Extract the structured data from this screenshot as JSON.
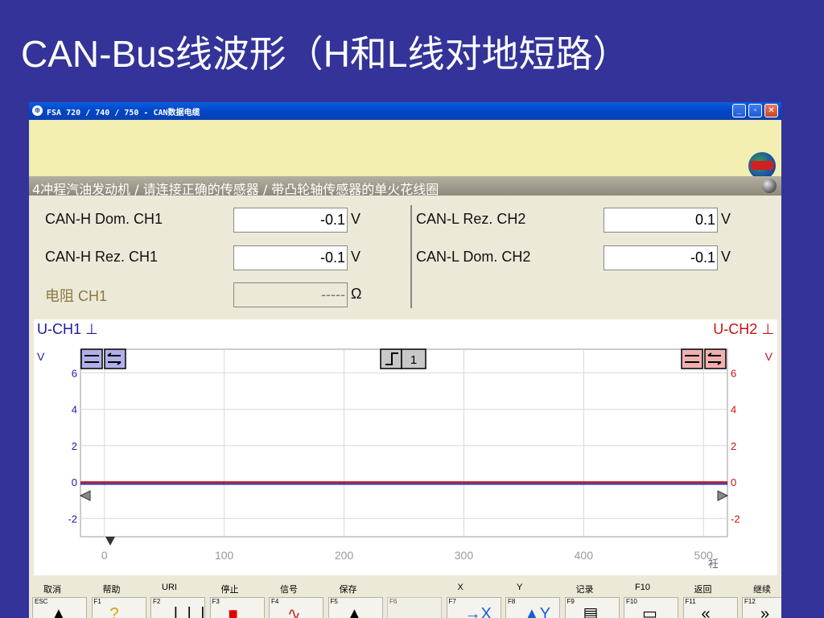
{
  "slide": {
    "title": "CAN-Bus线波形（H和L线对地短路）"
  },
  "window": {
    "title": "FSA 720 / 740 / 750 - CAN数据电缆",
    "icon": "app-icon",
    "controls": [
      "minimize",
      "maximize",
      "close"
    ]
  },
  "status": {
    "text": "4冲程汽油发动机 / 请连接正确的传感器 / 带凸轮轴传感器的单火花线圈"
  },
  "measurements": {
    "left": [
      {
        "label": "CAN-H Dom. CH1",
        "value": "-0.1",
        "unit": "V",
        "disabled": false
      },
      {
        "label": "CAN-H Rez. CH1",
        "value": "-0.1",
        "unit": "V",
        "disabled": false
      },
      {
        "label": "电阻 CH1",
        "value": "-----",
        "unit": "Ω",
        "disabled": true
      }
    ],
    "right": [
      {
        "label": "CAN-L Rez. CH2",
        "value": "0.1",
        "unit": "V"
      },
      {
        "label": "CAN-L Dom. CH2",
        "value": "-0.1",
        "unit": "V"
      }
    ]
  },
  "chart": {
    "ch1_label": "U-CH1",
    "ch2_label": "U-CH2",
    "y_unit_left": "V",
    "y_unit_right": "V",
    "trigger_label": "1",
    "corner_mark": "衽",
    "colors": {
      "ch1": "#1a1aa8",
      "ch2": "#cc1111",
      "ch1_btn": "#b0b0e8",
      "ch2_btn": "#f0b0b0"
    }
  },
  "chart_data": {
    "type": "line",
    "xlim": [
      -20,
      520
    ],
    "ylim": [
      -3,
      7.3
    ],
    "x_ticks": [
      0,
      100,
      200,
      300,
      400,
      500
    ],
    "x_tick_labels": [
      "0",
      "100",
      "200",
      "300",
      "400",
      "500"
    ],
    "y_ticks": [
      6,
      4,
      2,
      0,
      -2
    ],
    "y_tick_labels": [
      "6",
      "4",
      "2",
      "0",
      "-2"
    ],
    "grid": true,
    "series": [
      {
        "name": "U-CH1",
        "color": "#1a1aa8",
        "x": [
          -20,
          520
        ],
        "y": [
          -0.1,
          -0.1
        ]
      },
      {
        "name": "U-CH2",
        "color": "#cc1111",
        "x": [
          -20,
          520
        ],
        "y": [
          0.0,
          0.0
        ]
      }
    ]
  },
  "fkeys": [
    {
      "label": "取消",
      "key": "ESC",
      "icon": "up-arrow-icon",
      "glyph": "▲"
    },
    {
      "label": "帮助",
      "key": "F1",
      "icon": "help-icon",
      "glyph": "?"
    },
    {
      "label": "URI",
      "key": "F2",
      "icon": "gauge-icon",
      "glyph": "❘❘❘"
    },
    {
      "label": "停止",
      "key": "F3",
      "icon": "stop-icon",
      "glyph": "■"
    },
    {
      "label": "信号",
      "key": "F4",
      "icon": "signal-icon",
      "glyph": "∿"
    },
    {
      "label": "保存",
      "key": "F5",
      "icon": "save-icon",
      "glyph": "▲"
    },
    {
      "label": "",
      "key": "F6",
      "icon": "",
      "glyph": ""
    },
    {
      "label": "X",
      "key": "F7",
      "icon": "x-cursor-icon",
      "glyph": "→X"
    },
    {
      "label": "Y",
      "key": "F8",
      "icon": "y-cursor-icon",
      "glyph": "▲Y"
    },
    {
      "label": "记录",
      "key": "F9",
      "icon": "record-icon",
      "glyph": "▤"
    },
    {
      "label": "F10",
      "key": "F10",
      "icon": "tools-icon",
      "glyph": "▭"
    },
    {
      "label": "返回",
      "key": "F11",
      "icon": "back-icon",
      "glyph": "«"
    },
    {
      "label": "继续",
      "key": "F12",
      "icon": "forward-icon",
      "glyph": "»"
    }
  ]
}
